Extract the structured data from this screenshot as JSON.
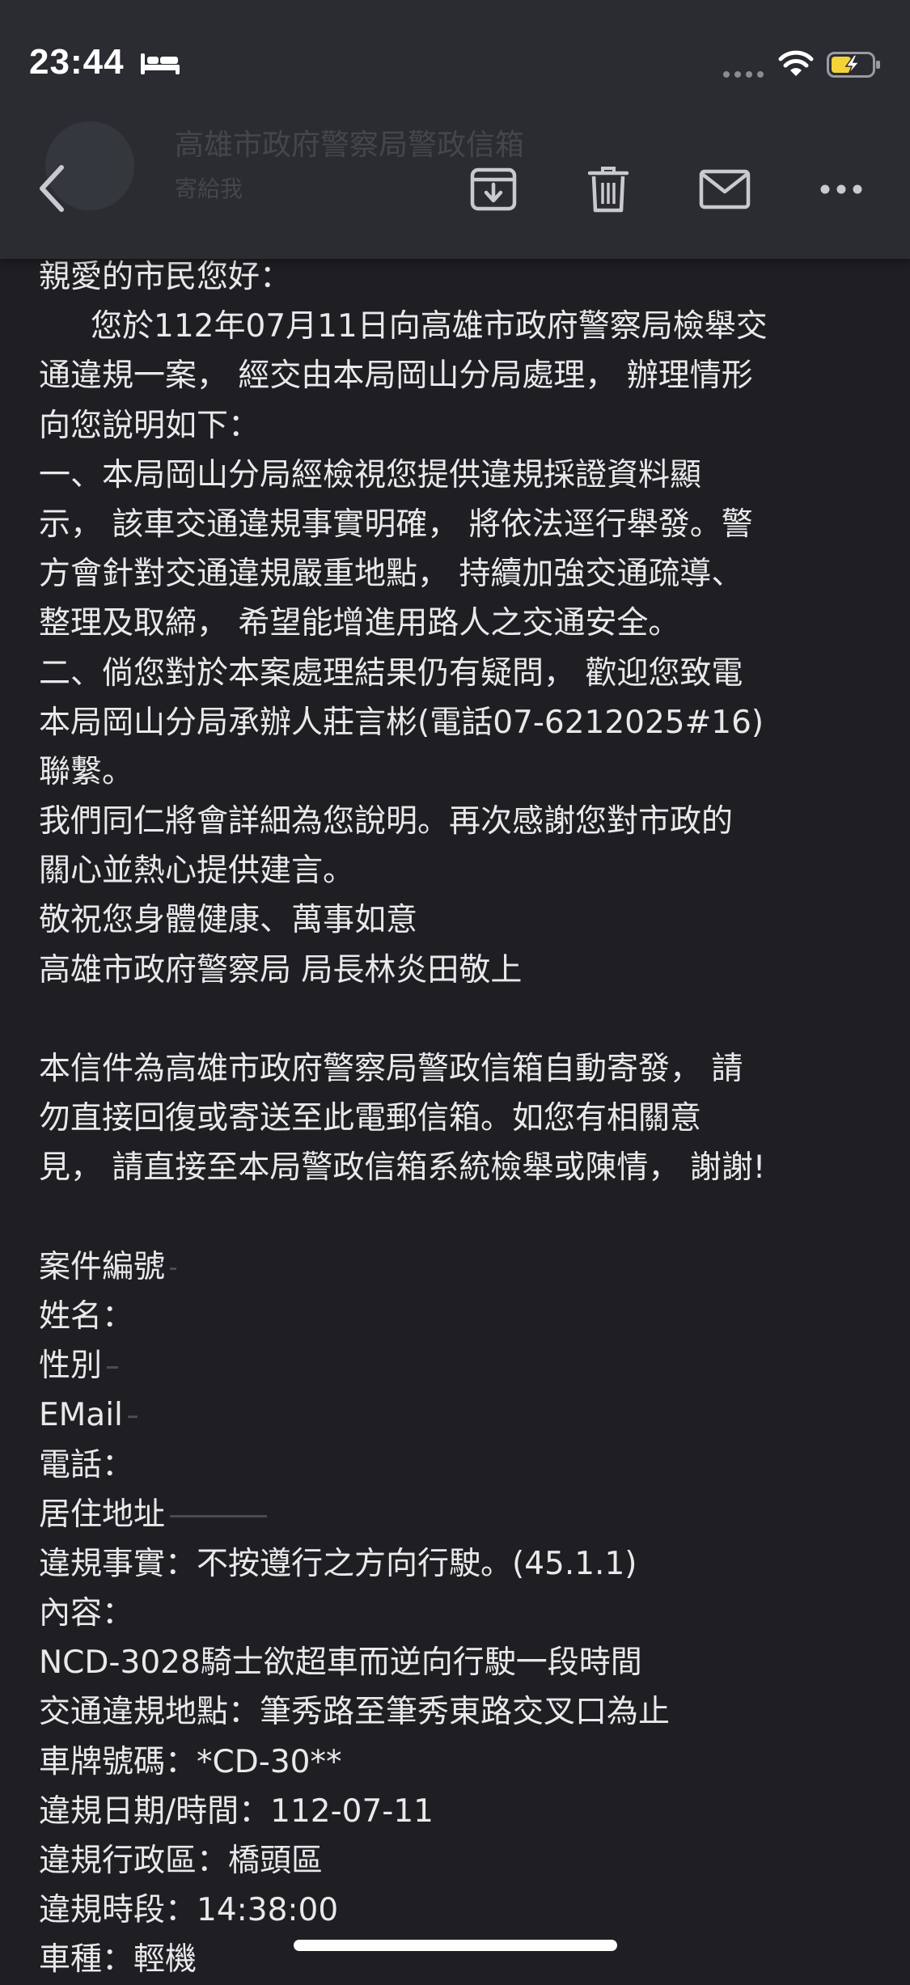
{
  "status_bar": {
    "time": "23:44",
    "icons": [
      "bed-icon",
      "signal-icon",
      "wifi-icon",
      "battery-charging-icon"
    ],
    "battery_color": "#f3d338"
  },
  "toolbar": {
    "ghost_sender": "高雄市政府警察局警政信箱",
    "ghost_sub": "寄給我",
    "actions": [
      "back-chevron-icon",
      "archive-icon",
      "trash-icon",
      "mail-icon",
      "more-dots-icon"
    ]
  },
  "email": {
    "greeting": "親愛的市民您好：",
    "body_lines": [
      "您於112年07月11日向高雄市政府警察局檢舉交",
      "通違規一案， 經交由本局岡山分局處理， 辦理情形",
      "向您說明如下：",
      "一、本局岡山分局經檢視您提供違規採證資料顯",
      "示， 該車交通違規事實明確， 將依法逕行舉發。警",
      "方會針對交通違規嚴重地點， 持續加強交通疏導、",
      "整理及取締， 希望能增進用路人之交通安全。",
      "二、倘您對於本案處理結果仍有疑問， 歡迎您致電",
      "本局岡山分局承辦人莊言彬(電話07-6212025#16)",
      "聯繫。",
      "我們同仁將會詳細為您說明。再次感謝您對市政的",
      "關心並熱心提供建言。",
      "敬祝您身體健康、萬事如意",
      "高雄市政府警察局 局長林炎田敬上"
    ],
    "notice_lines": [
      "本信件為高雄市政府警察局警政信箱自動寄發， 請",
      "勿直接回復或寄送至此電郵信箱。如您有相關意",
      "見， 請直接至本局警政信箱系統檢舉或陳情， 謝謝!"
    ],
    "fields": {
      "case_number": "案件編號",
      "name": "姓名：",
      "gender": "性別",
      "email": "EMail",
      "phone": "電話：",
      "address": "居住地址"
    },
    "details_lines": [
      "違規事實：不按遵行之方向行駛。(45.1.1)",
      "內容：",
      "NCD-3028騎士欲超車而逆向行駛一段時間",
      "交通違規地點：筆秀路至筆秀東路交叉口為止",
      "車牌號碼：*CD-30**",
      "違規日期/時間：112-07-11",
      "違規行政區：橋頭區",
      "違規時段：14:38:00",
      "車種：輕機"
    ]
  }
}
